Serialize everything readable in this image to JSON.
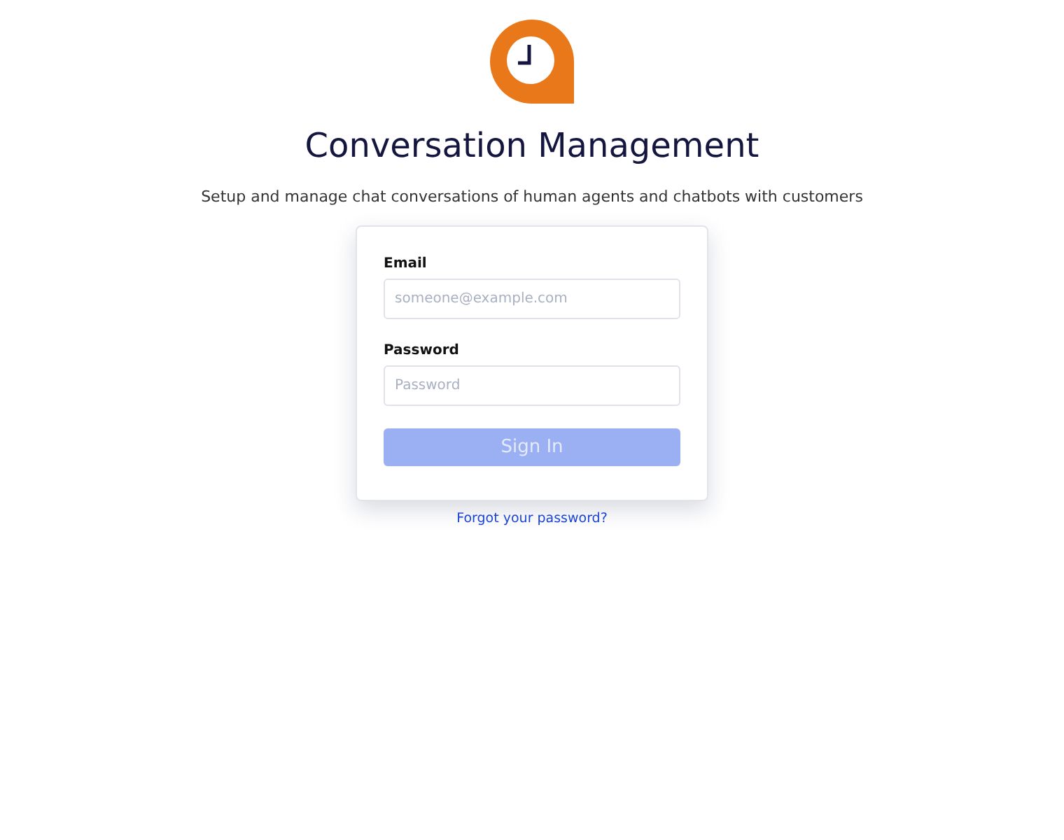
{
  "header": {
    "title": "Conversation Management",
    "subtitle": "Setup and manage chat conversations of human agents and chatbots with customers"
  },
  "form": {
    "fields": [
      {
        "label": "Email",
        "placeholder": "someone@example.com"
      },
      {
        "label": "Password",
        "placeholder": "Password"
      }
    ],
    "submit": {
      "label": "Sign In",
      "disabled": true
    }
  },
  "forgot_link": "Forgot your password?"
}
